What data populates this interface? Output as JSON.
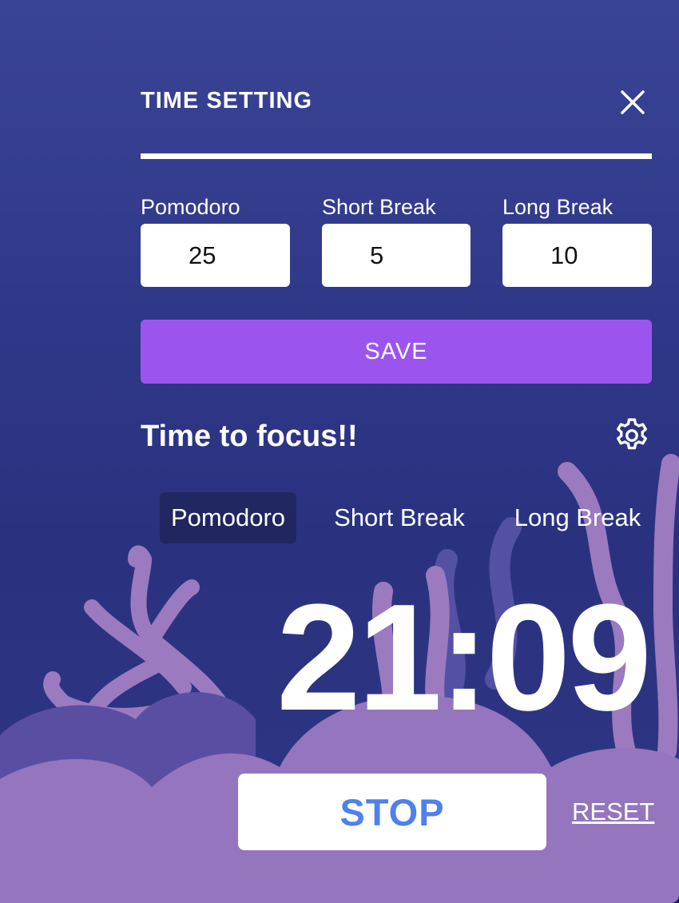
{
  "settings": {
    "title": "TIME SETTING",
    "fields": [
      {
        "label": "Pomodoro",
        "value": "25"
      },
      {
        "label": "Short Break",
        "value": "5"
      },
      {
        "label": "Long Break",
        "value": "10"
      }
    ],
    "save_label": "SAVE"
  },
  "main": {
    "heading": "Time to focus!!",
    "tabs": [
      {
        "label": "Pomodoro",
        "active": true
      },
      {
        "label": "Short Break",
        "active": false
      },
      {
        "label": "Long Break",
        "active": false
      }
    ],
    "timer": "21:09",
    "stop_label": "STOP",
    "reset_label": "RESET"
  },
  "icons": {
    "close": "close-icon",
    "settings": "gear-icon"
  },
  "colors": {
    "background": "#2f3888",
    "accent": "#9b55ee",
    "stop_text": "#4f80ec",
    "coral": "#9b7ac0"
  }
}
